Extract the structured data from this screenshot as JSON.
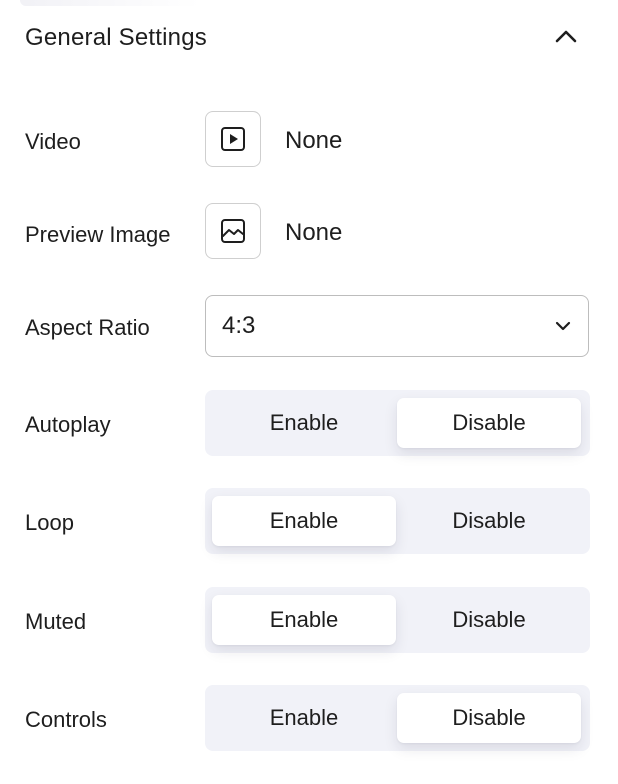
{
  "panel": {
    "title": "General Settings",
    "collapse_icon": "chevron-up-icon"
  },
  "video": {
    "label": "Video",
    "icon": "video-play-icon",
    "value": "None"
  },
  "preview_image": {
    "label": "Preview Image",
    "icon": "image-icon",
    "value": "None"
  },
  "aspect_ratio": {
    "label": "Aspect Ratio",
    "value": "4:3",
    "icon": "chevron-down-icon"
  },
  "toggles": [
    {
      "label": "Autoplay",
      "enable": "Enable",
      "disable": "Disable",
      "selected": "Disable"
    },
    {
      "label": "Loop",
      "enable": "Enable",
      "disable": "Disable",
      "selected": "Enable"
    },
    {
      "label": "Muted",
      "enable": "Enable",
      "disable": "Disable",
      "selected": "Enable"
    },
    {
      "label": "Controls",
      "enable": "Enable",
      "disable": "Disable",
      "selected": "Disable"
    }
  ],
  "colors": {
    "text": "#1e1e1e",
    "toggle_track": "#f1f2f8",
    "active_option": "#ffffff",
    "border": "#cfcfcf"
  }
}
